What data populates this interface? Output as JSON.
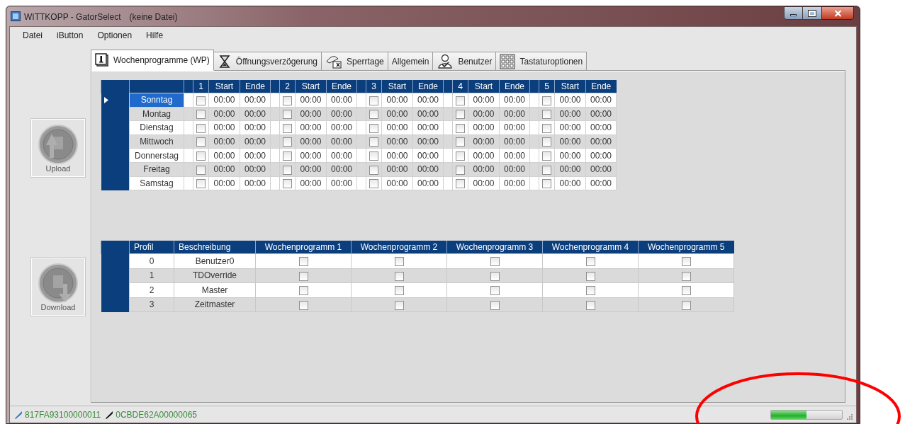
{
  "window": {
    "title": "WITTKOPP - GatorSelect",
    "file": "(keine Datei)"
  },
  "menu": [
    "Datei",
    "iButton",
    "Optionen",
    "Hilfe"
  ],
  "side_buttons": [
    {
      "label": "Upload"
    },
    {
      "label": "Download"
    }
  ],
  "tabs": [
    {
      "label": "Wochenprogramme (WP)",
      "selected": true
    },
    {
      "label": "Öffnungsverzögerung",
      "selected": false
    },
    {
      "label": "Sperrtage",
      "selected": false
    },
    {
      "label": "Allgemein",
      "selected": false
    },
    {
      "label": "Benutzer",
      "selected": false
    },
    {
      "label": "Tastaturoptionen",
      "selected": false
    }
  ],
  "schedule": {
    "slot_headers": [
      {
        "number": "1",
        "start": "Start",
        "end": "Ende"
      },
      {
        "number": "2",
        "start": "Start",
        "end": "Ende"
      },
      {
        "number": "3",
        "start": "Start",
        "end": "Ende"
      },
      {
        "number": "4",
        "start": "Start",
        "end": "Ende"
      },
      {
        "number": "5",
        "start": "Start",
        "end": "Ende"
      }
    ],
    "days": [
      {
        "name": "Sonntag",
        "selected": true,
        "slots": [
          {
            "checked": false,
            "start": "00:00",
            "end": "00:00"
          },
          {
            "checked": false,
            "start": "00:00",
            "end": "00:00"
          },
          {
            "checked": false,
            "start": "00:00",
            "end": "00:00"
          },
          {
            "checked": false,
            "start": "00:00",
            "end": "00:00"
          },
          {
            "checked": false,
            "start": "00:00",
            "end": "00:00"
          }
        ]
      },
      {
        "name": "Montag",
        "selected": false,
        "slots": [
          {
            "checked": false,
            "start": "00:00",
            "end": "00:00"
          },
          {
            "checked": false,
            "start": "00:00",
            "end": "00:00"
          },
          {
            "checked": false,
            "start": "00:00",
            "end": "00:00"
          },
          {
            "checked": false,
            "start": "00:00",
            "end": "00:00"
          },
          {
            "checked": false,
            "start": "00:00",
            "end": "00:00"
          }
        ]
      },
      {
        "name": "Dienstag",
        "selected": false,
        "slots": [
          {
            "checked": false,
            "start": "00:00",
            "end": "00:00"
          },
          {
            "checked": false,
            "start": "00:00",
            "end": "00:00"
          },
          {
            "checked": false,
            "start": "00:00",
            "end": "00:00"
          },
          {
            "checked": false,
            "start": "00:00",
            "end": "00:00"
          },
          {
            "checked": false,
            "start": "00:00",
            "end": "00:00"
          }
        ]
      },
      {
        "name": "Mittwoch",
        "selected": false,
        "slots": [
          {
            "checked": false,
            "start": "00:00",
            "end": "00:00"
          },
          {
            "checked": false,
            "start": "00:00",
            "end": "00:00"
          },
          {
            "checked": false,
            "start": "00:00",
            "end": "00:00"
          },
          {
            "checked": false,
            "start": "00:00",
            "end": "00:00"
          },
          {
            "checked": false,
            "start": "00:00",
            "end": "00:00"
          }
        ]
      },
      {
        "name": "Donnerstag",
        "selected": false,
        "slots": [
          {
            "checked": false,
            "start": "00:00",
            "end": "00:00"
          },
          {
            "checked": false,
            "start": "00:00",
            "end": "00:00"
          },
          {
            "checked": false,
            "start": "00:00",
            "end": "00:00"
          },
          {
            "checked": false,
            "start": "00:00",
            "end": "00:00"
          },
          {
            "checked": false,
            "start": "00:00",
            "end": "00:00"
          }
        ]
      },
      {
        "name": "Freitag",
        "selected": false,
        "slots": [
          {
            "checked": false,
            "start": "00:00",
            "end": "00:00"
          },
          {
            "checked": false,
            "start": "00:00",
            "end": "00:00"
          },
          {
            "checked": false,
            "start": "00:00",
            "end": "00:00"
          },
          {
            "checked": false,
            "start": "00:00",
            "end": "00:00"
          },
          {
            "checked": false,
            "start": "00:00",
            "end": "00:00"
          }
        ]
      },
      {
        "name": "Samstag",
        "selected": false,
        "slots": [
          {
            "checked": false,
            "start": "00:00",
            "end": "00:00"
          },
          {
            "checked": false,
            "start": "00:00",
            "end": "00:00"
          },
          {
            "checked": false,
            "start": "00:00",
            "end": "00:00"
          },
          {
            "checked": false,
            "start": "00:00",
            "end": "00:00"
          },
          {
            "checked": false,
            "start": "00:00",
            "end": "00:00"
          }
        ]
      }
    ]
  },
  "profiles": {
    "columns": [
      "Profil",
      "Beschreibung",
      "Wochenprogramm 1",
      "Wochenprogramm 2",
      "Wochenprogramm 3",
      "Wochenprogramm 4",
      "Wochenprogramm 5"
    ],
    "rows": [
      {
        "id": "0",
        "description": "Benutzer0",
        "programs": [
          {
            "checked": false
          },
          {
            "checked": false
          },
          {
            "checked": false
          },
          {
            "checked": false
          },
          {
            "checked": false
          }
        ]
      },
      {
        "id": "1",
        "description": "TDOverride",
        "programs": [
          {
            "checked": false
          },
          {
            "checked": false
          },
          {
            "checked": false
          },
          {
            "checked": false
          },
          {
            "checked": false
          }
        ]
      },
      {
        "id": "2",
        "description": "Master",
        "programs": [
          {
            "checked": false
          },
          {
            "checked": false
          },
          {
            "checked": false
          },
          {
            "checked": false
          },
          {
            "checked": false
          }
        ]
      },
      {
        "id": "3",
        "description": "Zeitmaster",
        "programs": [
          {
            "checked": false
          },
          {
            "checked": false
          },
          {
            "checked": false
          },
          {
            "checked": false
          },
          {
            "checked": false
          }
        ]
      }
    ]
  },
  "status_bar": {
    "ibuttons": [
      {
        "id": "817FA93100000011",
        "color": "#2f76c4"
      },
      {
        "id": "0CBDE62A00000065",
        "color": "#111111"
      }
    ],
    "progress": {
      "level": 0.5
    }
  }
}
